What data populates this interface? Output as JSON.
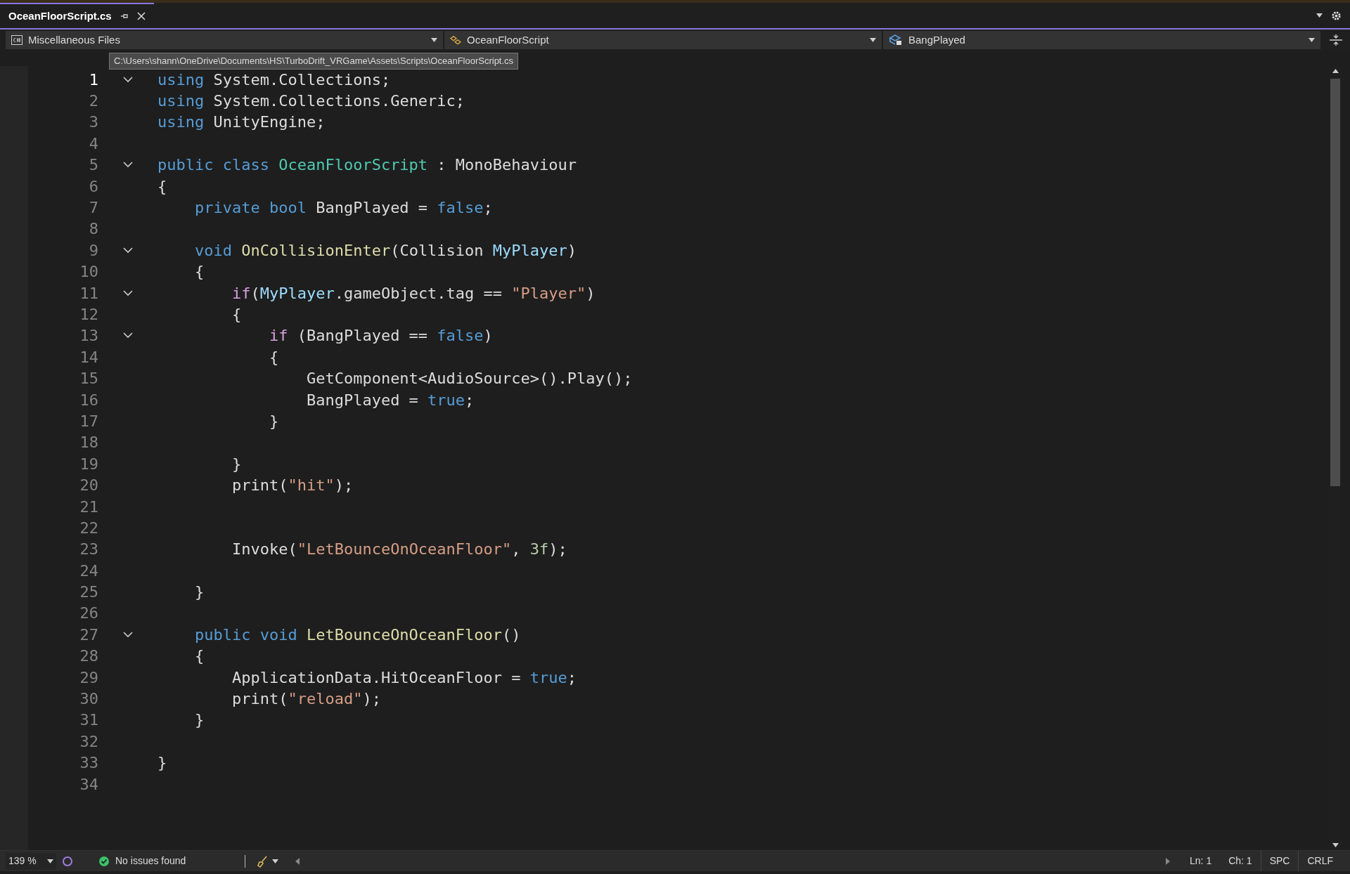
{
  "tab": {
    "label": "OceanFloorScript.cs",
    "selected": true
  },
  "nav": {
    "project": "Miscellaneous Files",
    "type": "OceanFloorScript",
    "member": "BangPlayed"
  },
  "tooltip": "C:\\Users\\shann\\OneDrive\\Documents\\HS\\TurboDrift_VRGame\\Assets\\Scripts\\OceanFloorScript.cs",
  "lines": [
    {
      "number": "1",
      "current": true,
      "fold": true,
      "tokens": [
        {
          "kind": "keyword",
          "text": "using"
        },
        {
          "kind": "plain",
          "text": " System.Collections;"
        }
      ]
    },
    {
      "number": "2",
      "current": false,
      "fold": false,
      "tokens": [
        {
          "kind": "keyword",
          "text": "using"
        },
        {
          "kind": "plain",
          "text": " System.Collections.Generic;"
        }
      ]
    },
    {
      "number": "3",
      "current": false,
      "fold": false,
      "tokens": [
        {
          "kind": "keyword",
          "text": "using"
        },
        {
          "kind": "plain",
          "text": " UnityEngine;"
        }
      ]
    },
    {
      "number": "4",
      "current": false,
      "fold": false
    },
    {
      "number": "5",
      "current": false,
      "fold": true,
      "tokens": [
        {
          "kind": "keyword",
          "text": "public class "
        },
        {
          "kind": "type",
          "text": "OceanFloorScript"
        },
        {
          "kind": "plain",
          "text": " : MonoBehaviour"
        }
      ]
    },
    {
      "number": "6",
      "current": false,
      "fold": false,
      "tokens": [
        {
          "kind": "plain",
          "text": "{"
        }
      ]
    },
    {
      "number": "7",
      "current": false,
      "fold": false,
      "tokens": [
        {
          "kind": "keyword",
          "text": "    private bool"
        },
        {
          "kind": "plain",
          "text": " BangPlayed = "
        },
        {
          "kind": "keyword",
          "text": "false"
        },
        {
          "kind": "plain",
          "text": ";"
        }
      ]
    },
    {
      "number": "8",
      "current": false,
      "fold": false
    },
    {
      "number": "9",
      "current": false,
      "fold": true,
      "tokens": [
        {
          "kind": "keyword",
          "text": "    void "
        },
        {
          "kind": "method",
          "text": "OnCollisionEnter"
        },
        {
          "kind": "plain",
          "text": "(Collision "
        },
        {
          "kind": "param",
          "text": "MyPlayer"
        },
        {
          "kind": "plain",
          "text": ")"
        }
      ]
    },
    {
      "number": "10",
      "current": false,
      "fold": false,
      "tokens": [
        {
          "kind": "plain",
          "text": "    {"
        }
      ]
    },
    {
      "number": "11",
      "current": false,
      "fold": true,
      "tokens": [
        {
          "kind": "control",
          "text": "        if"
        },
        {
          "kind": "plain",
          "text": "("
        },
        {
          "kind": "param",
          "text": "MyPlayer"
        },
        {
          "kind": "plain",
          "text": ".gameObject.tag == "
        },
        {
          "kind": "string",
          "text": "\"Player\""
        },
        {
          "kind": "plain",
          "text": ")"
        }
      ]
    },
    {
      "number": "12",
      "current": false,
      "fold": false,
      "tokens": [
        {
          "kind": "plain",
          "text": "        {"
        }
      ]
    },
    {
      "number": "13",
      "current": false,
      "fold": true,
      "tokens": [
        {
          "kind": "control",
          "text": "            if"
        },
        {
          "kind": "plain",
          "text": " (BangPlayed == "
        },
        {
          "kind": "keyword",
          "text": "false"
        },
        {
          "kind": "plain",
          "text": ")"
        }
      ]
    },
    {
      "number": "14",
      "current": false,
      "fold": false,
      "tokens": [
        {
          "kind": "plain",
          "text": "            {"
        }
      ]
    },
    {
      "number": "15",
      "current": false,
      "fold": false,
      "tokens": [
        {
          "kind": "plain",
          "text": "                GetComponent<AudioSource>().Play();"
        }
      ]
    },
    {
      "number": "16",
      "current": false,
      "fold": false,
      "tokens": [
        {
          "kind": "plain",
          "text": "                BangPlayed = "
        },
        {
          "kind": "keyword",
          "text": "true"
        },
        {
          "kind": "plain",
          "text": ";"
        }
      ]
    },
    {
      "number": "17",
      "current": false,
      "fold": false,
      "tokens": [
        {
          "kind": "plain",
          "text": "            }"
        }
      ]
    },
    {
      "number": "18",
      "current": false,
      "fold": false
    },
    {
      "number": "19",
      "current": false,
      "fold": false,
      "tokens": [
        {
          "kind": "plain",
          "text": "        }"
        }
      ]
    },
    {
      "number": "20",
      "current": false,
      "fold": false,
      "tokens": [
        {
          "kind": "plain",
          "text": "        print("
        },
        {
          "kind": "string",
          "text": "\"hit\""
        },
        {
          "kind": "plain",
          "text": ");"
        }
      ]
    },
    {
      "number": "21",
      "current": false,
      "fold": false
    },
    {
      "number": "22",
      "current": false,
      "fold": false
    },
    {
      "number": "23",
      "current": false,
      "fold": false,
      "tokens": [
        {
          "kind": "plain",
          "text": "        Invoke("
        },
        {
          "kind": "string",
          "text": "\"LetBounceOnOceanFloor\""
        },
        {
          "kind": "plain",
          "text": ", "
        },
        {
          "kind": "number",
          "text": "3f"
        },
        {
          "kind": "plain",
          "text": ");"
        }
      ]
    },
    {
      "number": "24",
      "current": false,
      "fold": false
    },
    {
      "number": "25",
      "current": false,
      "fold": false,
      "tokens": [
        {
          "kind": "plain",
          "text": "    }"
        }
      ]
    },
    {
      "number": "26",
      "current": false,
      "fold": false
    },
    {
      "number": "27",
      "current": false,
      "fold": true,
      "tokens": [
        {
          "kind": "keyword",
          "text": "    public void "
        },
        {
          "kind": "method",
          "text": "LetBounceOnOceanFloor"
        },
        {
          "kind": "plain",
          "text": "()"
        }
      ]
    },
    {
      "number": "28",
      "current": false,
      "fold": false,
      "tokens": [
        {
          "kind": "plain",
          "text": "    {"
        }
      ]
    },
    {
      "number": "29",
      "current": false,
      "fold": false,
      "tokens": [
        {
          "kind": "plain",
          "text": "        ApplicationData.HitOceanFloor = "
        },
        {
          "kind": "keyword",
          "text": "true"
        },
        {
          "kind": "plain",
          "text": ";"
        }
      ]
    },
    {
      "number": "30",
      "current": false,
      "fold": false,
      "tokens": [
        {
          "kind": "plain",
          "text": "        print("
        },
        {
          "kind": "string",
          "text": "\"reload\""
        },
        {
          "kind": "plain",
          "text": ");"
        }
      ]
    },
    {
      "number": "31",
      "current": false,
      "fold": false,
      "tokens": [
        {
          "kind": "plain",
          "text": "    }"
        }
      ]
    },
    {
      "number": "32",
      "current": false,
      "fold": false
    },
    {
      "number": "33",
      "current": false,
      "fold": false,
      "tokens": [
        {
          "kind": "plain",
          "text": "}"
        }
      ]
    },
    {
      "number": "34",
      "current": false,
      "fold": false
    }
  ],
  "status": {
    "zoom": "139 %",
    "issues": "No issues found",
    "line": "Ln: 1",
    "column": "Ch: 1",
    "whitespace": "SPC",
    "line_ending": "CRLF"
  }
}
